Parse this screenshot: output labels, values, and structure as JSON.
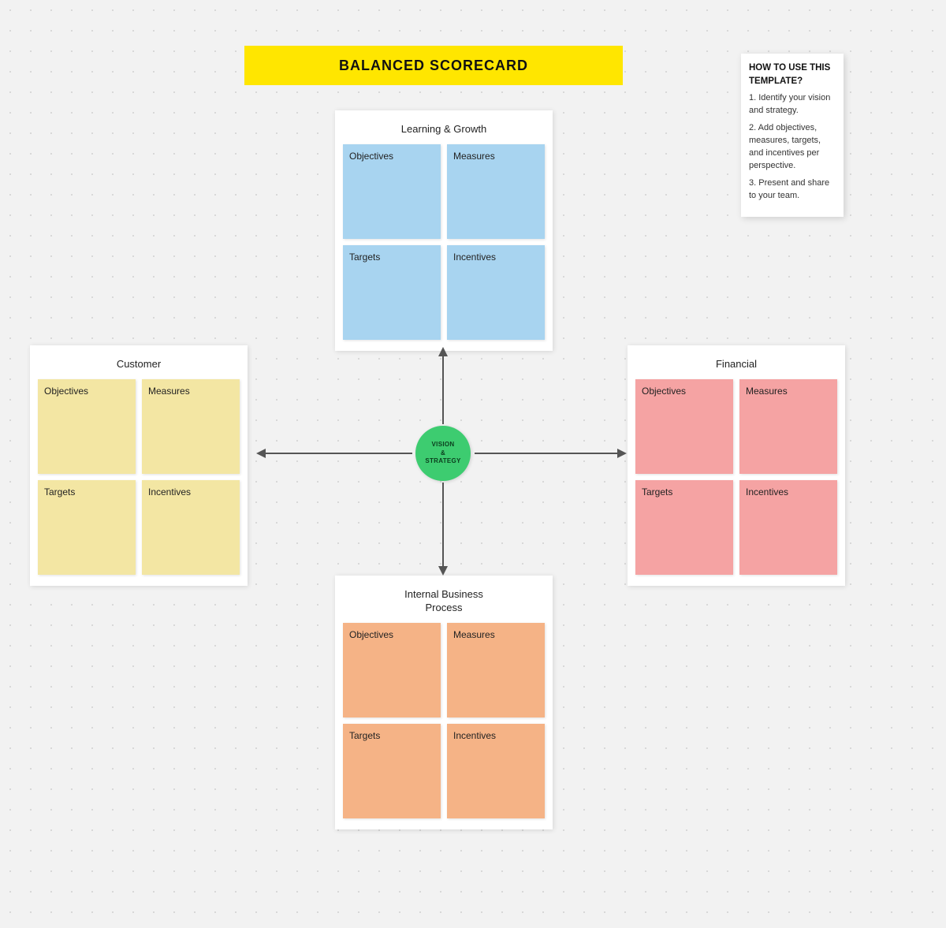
{
  "title": "BALANCED SCORECARD",
  "center": {
    "line1": "VISION",
    "line2": "&",
    "line3": "STRATEGY"
  },
  "help": {
    "title": "HOW TO USE THIS TEMPLATE?",
    "steps": [
      "1. Identify your vision and strategy.",
      "2. Add objectives, measures, targets, and incentives per perspective.",
      "3. Present and share to your team."
    ]
  },
  "perspectives": {
    "top": {
      "title": "Learning & Growth",
      "cells": [
        "Objectives",
        "Measures",
        "Targets",
        "Incentives"
      ]
    },
    "left": {
      "title": "Customer",
      "cells": [
        "Objectives",
        "Measures",
        "Targets",
        "Incentives"
      ]
    },
    "right": {
      "title": "Financial",
      "cells": [
        "Objectives",
        "Measures",
        "Targets",
        "Incentives"
      ]
    },
    "bottom": {
      "title": "Internal Business Process",
      "cells": [
        "Objectives",
        "Measures",
        "Targets",
        "Incentives"
      ]
    }
  },
  "colors": {
    "top": "#a8d4f0",
    "left": "#f3e6a3",
    "right": "#f5a3a3",
    "bottom": "#f5b386",
    "center": "#3dcc70",
    "banner": "#ffe600"
  }
}
